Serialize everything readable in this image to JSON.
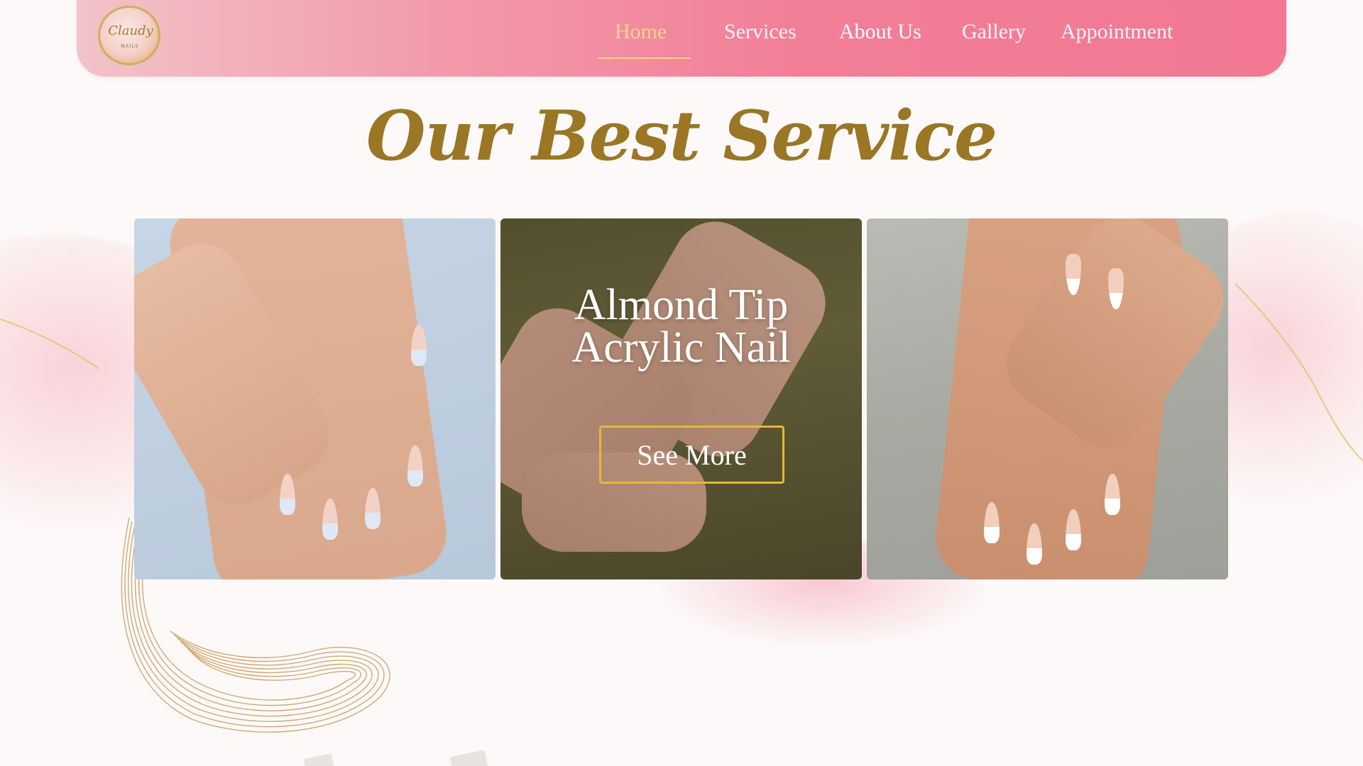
{
  "header": {
    "logo_text": "Claudy",
    "logo_sub": "NAILS",
    "nav": {
      "home": "Home",
      "services": "Services",
      "about": "About Us",
      "gallery": "Gallery",
      "appointment": "Appointment"
    },
    "active_item": "Home"
  },
  "section": {
    "title": "Our Best Service"
  },
  "cards": [
    {
      "image": "french-tip-bow-nails"
    },
    {
      "image": "almond-tip-acrylic-nails",
      "title_line1": "Almond Tip",
      "title_line2": "Acrylic Nail",
      "button": "See More"
    },
    {
      "image": "pearl-french-tip-nails"
    }
  ],
  "colors": {
    "header_gradient_start": "#f2c3c8",
    "header_gradient_end": "#f27894",
    "active_nav": "#f7d58a",
    "title_gold": "#9a7625",
    "button_border": "#e9b733"
  }
}
